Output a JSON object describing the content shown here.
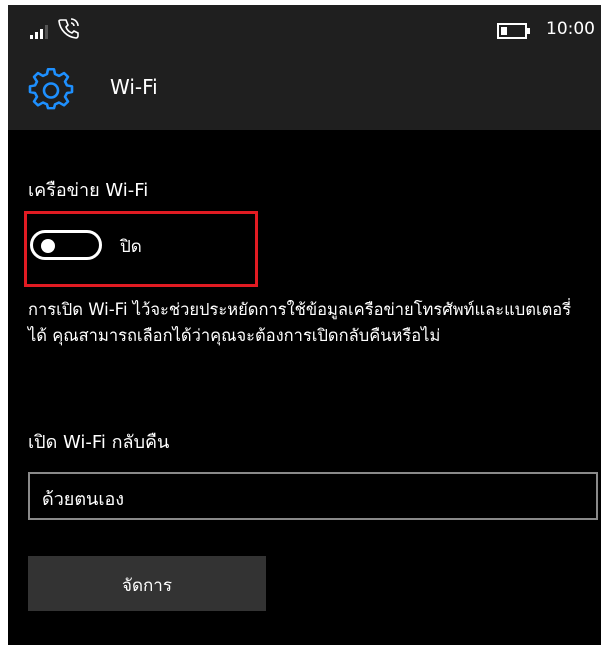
{
  "status_bar": {
    "time": "10:00",
    "signal_icon": "signal-bars-icon",
    "call_icon": "wifi-calling-icon",
    "battery_icon": "battery-icon"
  },
  "header": {
    "icon": "gear-icon",
    "title": "Wi-Fi"
  },
  "wifi_network": {
    "label": "เครือข่าย Wi-Fi",
    "toggle_state": "ปิด",
    "toggle_on": false
  },
  "description": "การเปิด Wi-Fi ไว้จะช่วยประหยัดการใช้ข้อมูลเครือข่ายโทรศัพท์และแบตเตอรี่ได้ คุณสามารถเลือกได้ว่าคุณจะต้องการเปิดกลับคืนหรือไม่",
  "reenable": {
    "label": "เปิด Wi-Fi กลับคืน",
    "selected": "ด้วยตนเอง"
  },
  "manage_button": {
    "label": "จัดการ"
  },
  "colors": {
    "background": "#000000",
    "bar": "#1f1f1f",
    "accent": "#1e90ff",
    "highlight": "#e11b22",
    "button": "#333333"
  }
}
